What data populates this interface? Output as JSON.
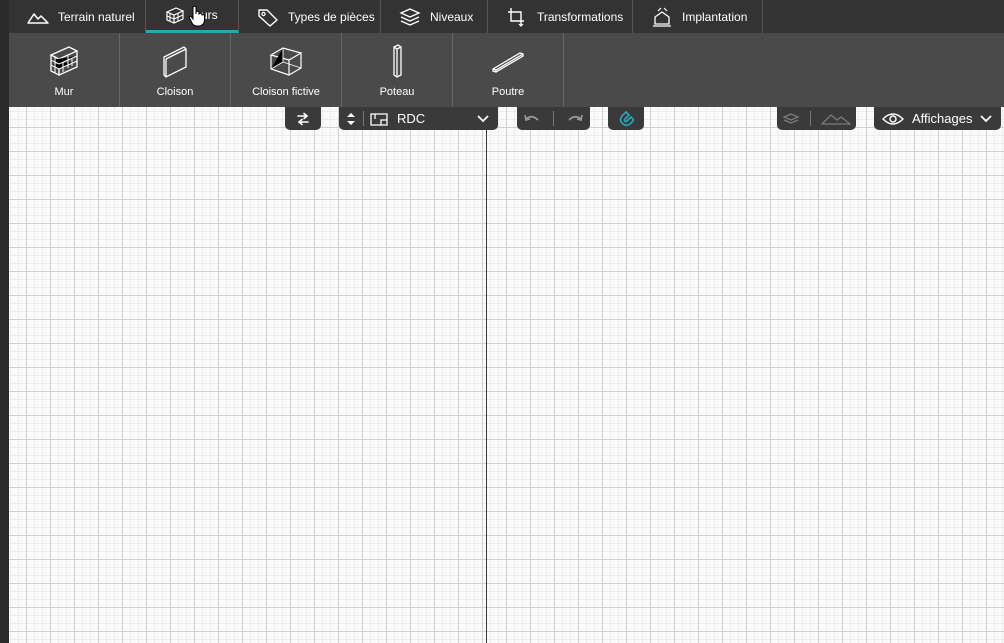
{
  "tabs": [
    {
      "label": "Terrain naturel",
      "icon": "mountain-icon",
      "active": false
    },
    {
      "label": "Murs",
      "icon": "wall-icon",
      "active": true
    },
    {
      "label": "Types de pièces",
      "icon": "tag-icon",
      "active": false
    },
    {
      "label": "Niveaux",
      "icon": "layers-icon",
      "active": false
    },
    {
      "label": "Transformations",
      "icon": "crop-icon",
      "active": false
    },
    {
      "label": "Implantation",
      "icon": "implantation-icon",
      "active": false
    }
  ],
  "murs_tab_label_visible": "urs",
  "tools": [
    {
      "label": "Mur",
      "icon": "brick-wall-icon"
    },
    {
      "label": "Cloison",
      "icon": "partition-icon"
    },
    {
      "label": "Cloison fictive",
      "icon": "wireframe-box-icon"
    },
    {
      "label": "Poteau",
      "icon": "column-icon"
    },
    {
      "label": "Poutre",
      "icon": "beam-icon"
    }
  ],
  "level_select": {
    "value": "RDC"
  },
  "display_menu": {
    "label": "Affichages"
  },
  "colors": {
    "accent": "#27a8b8",
    "bar": "#333333",
    "ribbon": "#4a4a4a"
  }
}
